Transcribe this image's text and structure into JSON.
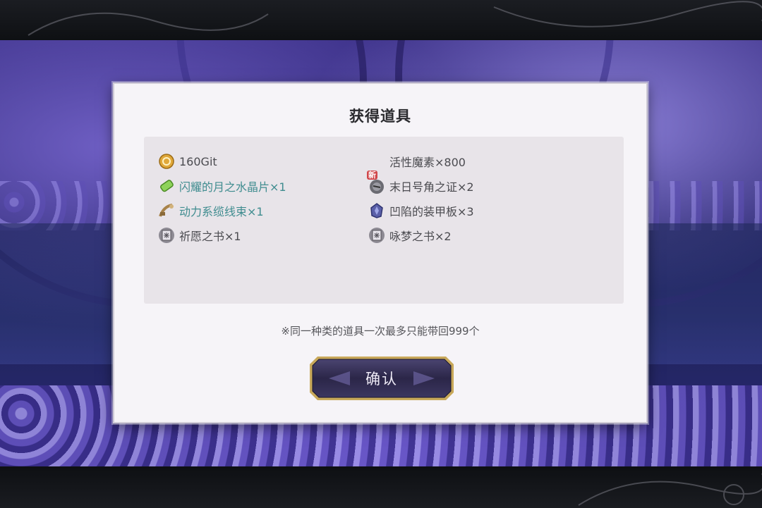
{
  "dialog": {
    "title": "获得道具",
    "note": "※同一种类的道具一次最多只能带回999个",
    "confirm_label": "确认"
  },
  "items": [
    {
      "label": "160Git",
      "icon": "coin-icon",
      "rare": false
    },
    {
      "label": "活性魔素×800",
      "icon": "none",
      "rare": false
    },
    {
      "label": "闪耀的月之水晶片×1",
      "icon": "green-crystal-icon",
      "rare": true
    },
    {
      "label": "末日号角之证×2",
      "icon": "dark-orb-icon",
      "rare": false,
      "badge": "新"
    },
    {
      "label": "动力系缆线束×1",
      "icon": "cable-icon",
      "rare": true
    },
    {
      "label": "凹陷的装甲板×3",
      "icon": "armor-plate-icon",
      "rare": false
    },
    {
      "label": "祈愿之书×1",
      "icon": "book-icon",
      "rare": false
    },
    {
      "label": "咏梦之书×2",
      "icon": "book-icon",
      "rare": false
    }
  ],
  "colors": {
    "rare_text": "#3f8c8f",
    "normal_text": "#4b4b50",
    "button_frame": "#c8a85a",
    "button_fill": "#2f2a4d"
  }
}
